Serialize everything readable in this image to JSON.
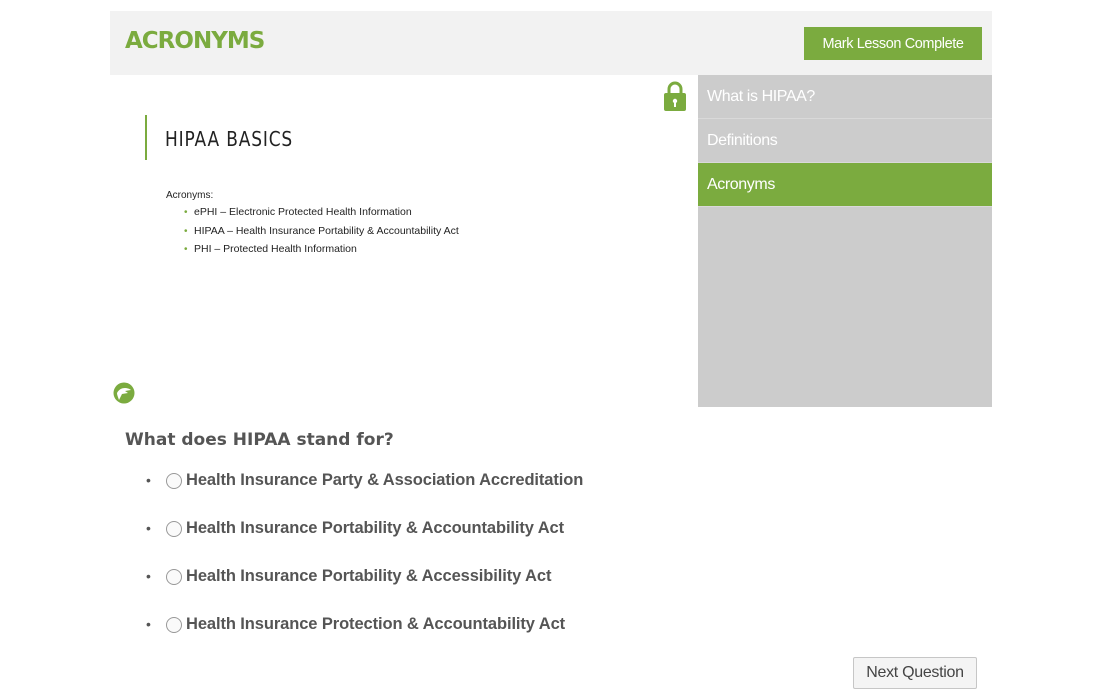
{
  "header": {
    "title": "ACRONYMS",
    "complete_button": "Mark Lesson Complete"
  },
  "slide": {
    "title": "HIPAA BASICS",
    "subtitle": "Acronyms:",
    "items": [
      "ePHI – Electronic Protected Health Information",
      "HIPAA – Health Insurance Portability & Accountability Act",
      "PHI – Protected Health Information"
    ]
  },
  "sidebar": {
    "items": [
      {
        "label": "What is HIPAA?"
      },
      {
        "label": "Definitions"
      },
      {
        "label": "Acronyms",
        "active": true
      }
    ]
  },
  "quiz": {
    "question": "What does HIPAA stand for?",
    "answers": [
      "Health Insurance Party & Association Accreditation",
      "Health Insurance Portability & Accountability Act",
      "Health Insurance Portability & Accessibility Act",
      "Health Insurance Protection & Accountability Act"
    ],
    "next_button": "Next Question"
  },
  "icons": {
    "lock": "lock-icon",
    "brand": "brand-logo-icon",
    "bullet": "•"
  },
  "colors": {
    "accent": "#7bab3f",
    "header_bg": "#f2f2f2",
    "sidebar_bg": "#cccccc"
  }
}
